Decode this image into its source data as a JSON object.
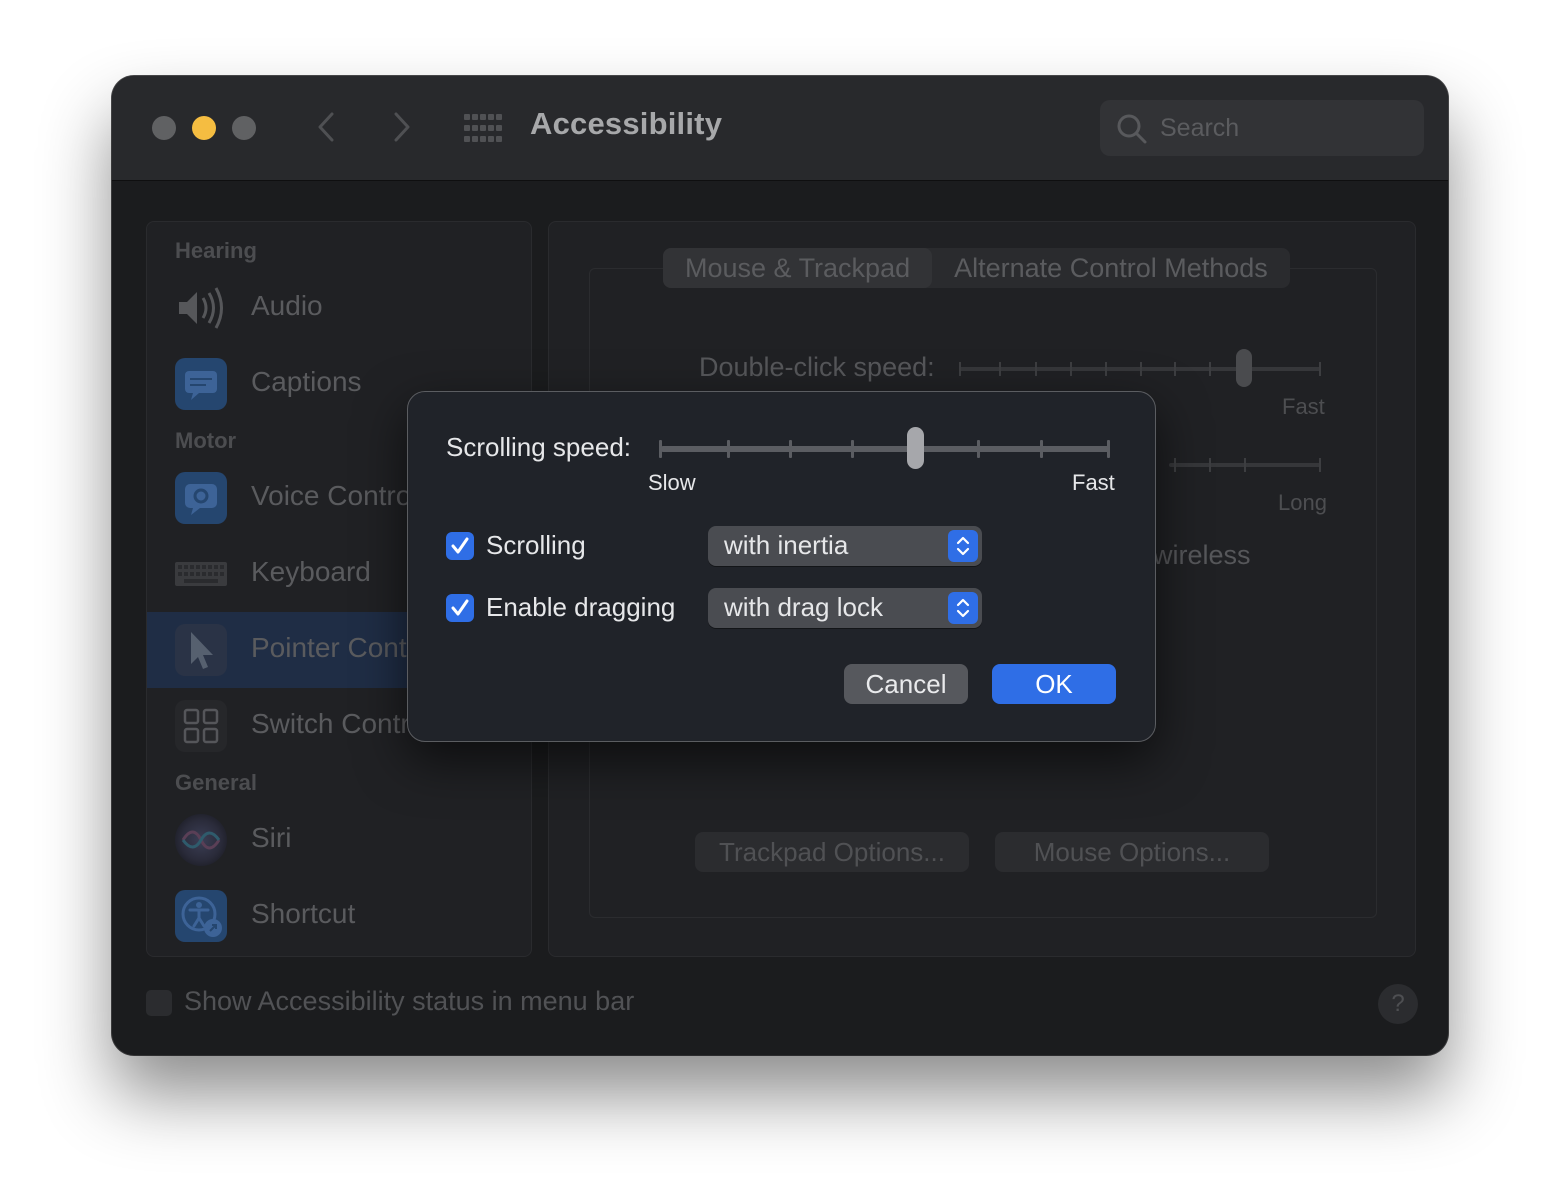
{
  "window": {
    "title": "Accessibility"
  },
  "search": {
    "placeholder": "Search"
  },
  "sidebar": {
    "sections": [
      {
        "label": "Hearing"
      },
      {
        "label": "Motor"
      },
      {
        "label": "General"
      }
    ],
    "items": [
      {
        "label": "Audio",
        "icon": "speaker-icon"
      },
      {
        "label": "Captions",
        "icon": "captions-icon"
      },
      {
        "label": "Voice Contro",
        "icon": "voice-control-icon"
      },
      {
        "label": "Keyboard",
        "icon": "keyboard-icon"
      },
      {
        "label": "Pointer Contr",
        "icon": "pointer-icon",
        "selected": true
      },
      {
        "label": "Switch Contr",
        "icon": "switch-control-icon"
      },
      {
        "label": "Siri",
        "icon": "siri-icon"
      },
      {
        "label": "Shortcut",
        "icon": "accessibility-shortcut-icon"
      }
    ]
  },
  "content": {
    "tabs": [
      {
        "label": "Mouse & Trackpad",
        "active": true
      },
      {
        "label": "Alternate Control Methods",
        "active": false
      }
    ],
    "double_click_label": "Double-click speed:",
    "double_click_max_label": "Fast",
    "second_slider_max_label": "Long",
    "wireless_text": "wireless",
    "trackpad_options_button": "Trackpad Options...",
    "mouse_options_button": "Mouse Options..."
  },
  "footer": {
    "status_label": "Show Accessibility status in menu bar",
    "status_checked": false,
    "help_label": "?"
  },
  "dialog": {
    "scrolling_speed_label": "Scrolling speed:",
    "slider_min_label": "Slow",
    "slider_max_label": "Fast",
    "scrolling_speed_value": 0.57,
    "scrolling_label": "Scrolling",
    "scrolling_checked": true,
    "scrolling_select": "with inertia",
    "dragging_label": "Enable dragging",
    "dragging_checked": true,
    "dragging_select": "with drag lock",
    "cancel_label": "Cancel",
    "ok_label": "OK"
  },
  "colors": {
    "accent": "#2f6ee6",
    "minimize": "#f5bd41",
    "window_bg": "#1b1c1e"
  }
}
